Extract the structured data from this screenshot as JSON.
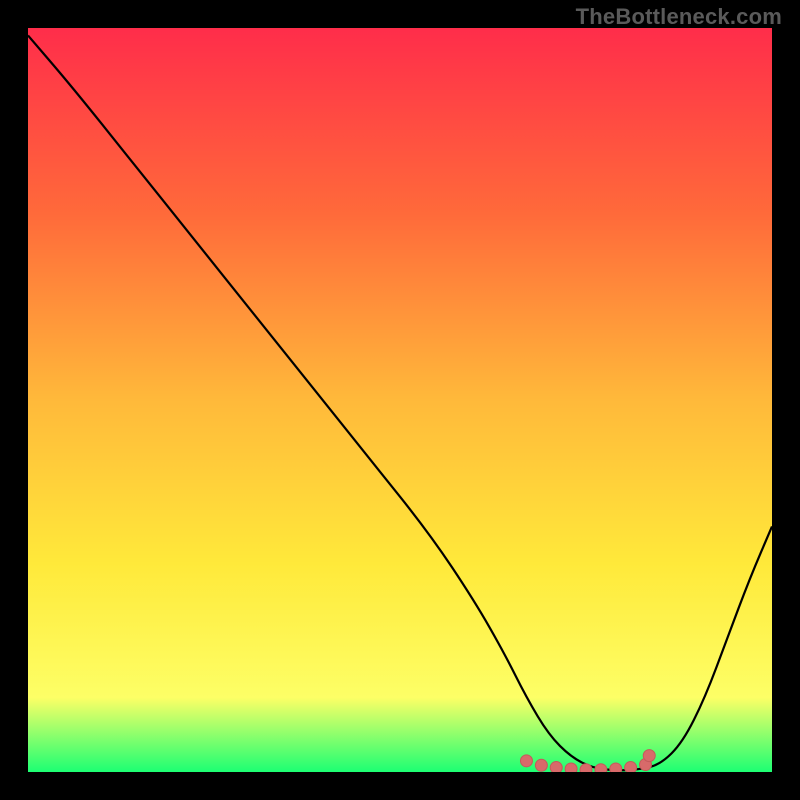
{
  "watermark": "TheBottleneck.com",
  "plot": {
    "background_gradient": {
      "top": "#ff2d4a",
      "mid1": "#ff6a3a",
      "mid2": "#ffb93a",
      "mid3": "#ffe93a",
      "mid4": "#fdff66",
      "bottom": "#1cff73"
    },
    "curve_color": "#000000",
    "marker_color": "#d86a6a",
    "marker_stroke": "#c55a5a"
  },
  "chart_data": {
    "type": "line",
    "title": "",
    "xlabel": "",
    "ylabel": "",
    "xlim": [
      0,
      100
    ],
    "ylim": [
      0,
      100
    ],
    "series": [
      {
        "name": "curve",
        "x": [
          0,
          6,
          14,
          22,
          30,
          38,
          46,
          54,
          60,
          64,
          67,
          70,
          73,
          76,
          79,
          82,
          85,
          88,
          91,
          94,
          97,
          100
        ],
        "values": [
          99,
          92,
          82,
          72,
          62,
          52,
          42,
          32,
          23,
          16,
          10,
          5,
          2,
          0.5,
          0.2,
          0.3,
          1,
          4,
          10,
          18,
          26,
          33
        ]
      }
    ],
    "markers": {
      "name": "bottom-cluster",
      "x": [
        67,
        69,
        71,
        73,
        75,
        77,
        79,
        81,
        83,
        83.5
      ],
      "values": [
        1.5,
        0.9,
        0.6,
        0.4,
        0.3,
        0.3,
        0.4,
        0.6,
        1.0,
        2.2
      ]
    }
  }
}
